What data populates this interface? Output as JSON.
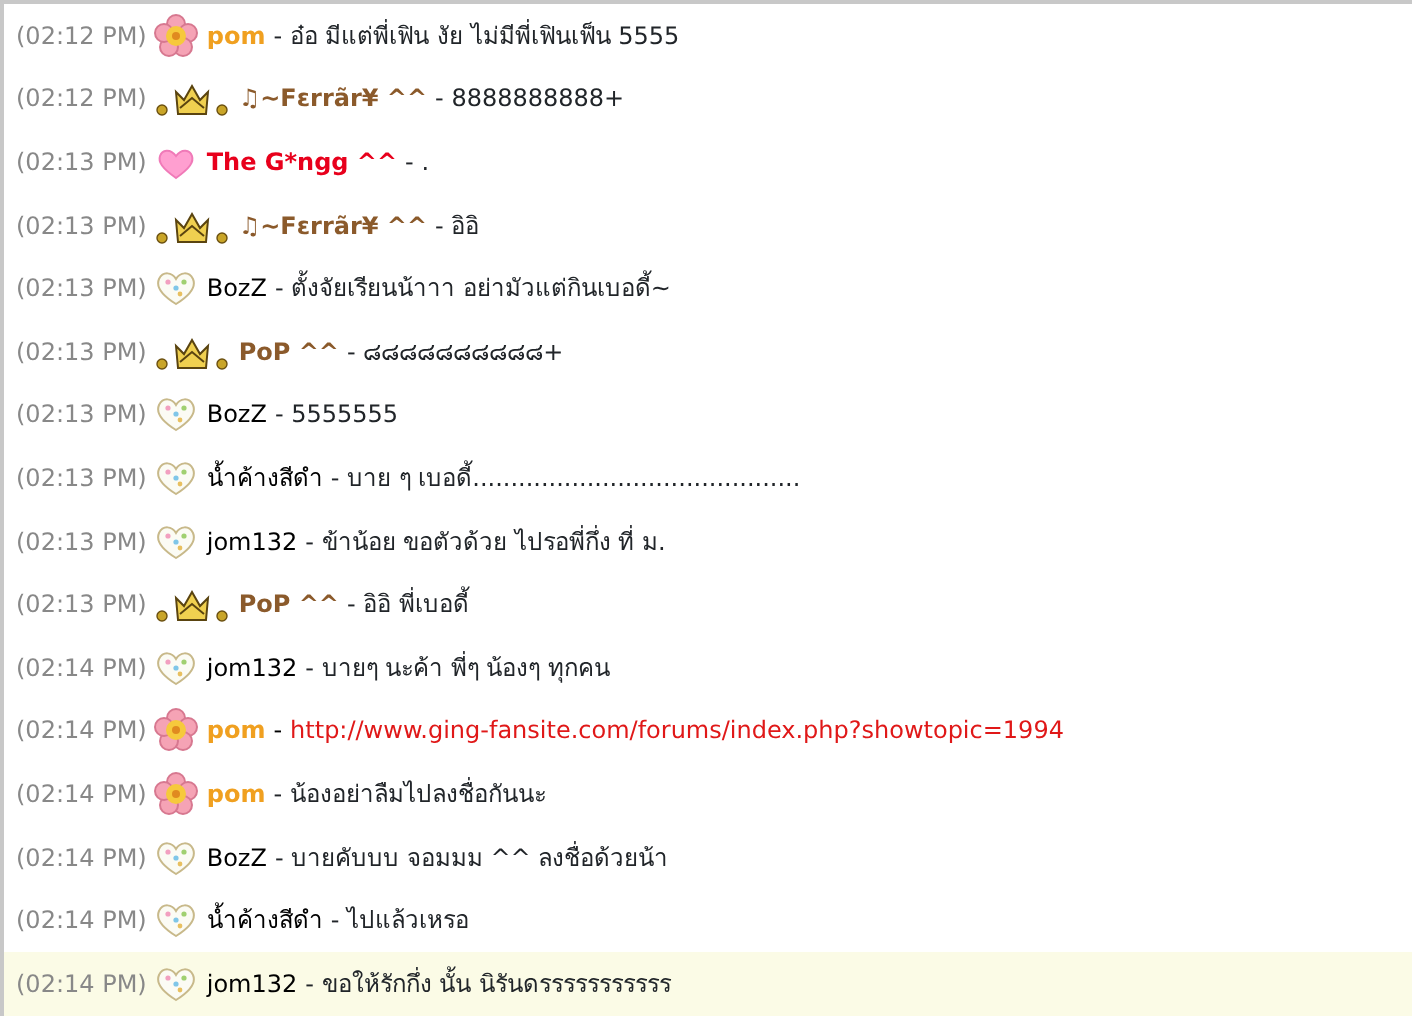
{
  "messages": [
    {
      "time": "(02:12 PM)",
      "kind": "flower",
      "name": "pom",
      "color": "#f0a020",
      "bold": true,
      "text": "- อ๋อ มีแต่พี่เฟิน งัย ไม่มีพี่เฟินเฟ็น 5555",
      "link": false,
      "selected": false
    },
    {
      "time": "(02:12 PM)",
      "kind": "crown",
      "name": "♫~Fɛrrãr¥ ^^",
      "color": "#8b5a2b",
      "bold": true,
      "text": "- 8888888888+",
      "link": false,
      "selected": false
    },
    {
      "time": "(02:13 PM)",
      "kind": "pink-heart",
      "name": "The G*ngg ^^",
      "color": "#e8001c",
      "bold": true,
      "text": "- .",
      "link": false,
      "selected": false
    },
    {
      "time": "(02:13 PM)",
      "kind": "crown",
      "name": "♫~Fɛrrãr¥ ^^",
      "color": "#8b5a2b",
      "bold": true,
      "text": "- อิอิ",
      "link": false,
      "selected": false
    },
    {
      "time": "(02:13 PM)",
      "kind": "heart",
      "name": "BozZ",
      "color": "#000000",
      "bold": false,
      "text": "- ตั้งจัยเรียนน้าาา อย่ามัวแต่กินเบอดี้~",
      "link": false,
      "selected": false
    },
    {
      "time": "(02:13 PM)",
      "kind": "crown",
      "name": "PoP ^^",
      "color": "#8b5a2b",
      "bold": true,
      "text": "- ๘๘๘๘๘๘๘๘๘๘+",
      "link": false,
      "selected": false
    },
    {
      "time": "(02:13 PM)",
      "kind": "heart",
      "name": "BozZ",
      "color": "#000000",
      "bold": false,
      "text": "- 5555555",
      "link": false,
      "selected": false
    },
    {
      "time": "(02:13 PM)",
      "kind": "heart",
      "name": "น้ำค้างสีดำ",
      "color": "#000000",
      "bold": false,
      "text": "- บาย ๆ เบอดี้...........................................",
      "link": false,
      "selected": false
    },
    {
      "time": "(02:13 PM)",
      "kind": "heart",
      "name": "jom132",
      "color": "#000000",
      "bold": false,
      "text": "- ข้าน้อย ขอตัวด้วย ไปรอพี่กึ่ง ที่ ม.",
      "link": false,
      "selected": false
    },
    {
      "time": "(02:13 PM)",
      "kind": "crown",
      "name": "PoP ^^",
      "color": "#8b5a2b",
      "bold": true,
      "text": "- อิอิ พี่เบอดี้",
      "link": false,
      "selected": false
    },
    {
      "time": "(02:14 PM)",
      "kind": "heart",
      "name": "jom132",
      "color": "#000000",
      "bold": false,
      "text": "- บายๆ นะค้า พี่ๆ น้องๆ ทุกคน",
      "link": false,
      "selected": false
    },
    {
      "time": "(02:14 PM)",
      "kind": "flower",
      "name": "pom",
      "color": "#f0a020",
      "bold": true,
      "prefix": "-",
      "text": "http://www.ging-fansite.com/forums/index.php?showtopic=1994",
      "link": true,
      "selected": false
    },
    {
      "time": "(02:14 PM)",
      "kind": "flower",
      "name": "pom",
      "color": "#f0a020",
      "bold": true,
      "text": "- น้องอย่าลืมไปลงชื่อกันนะ",
      "link": false,
      "selected": false
    },
    {
      "time": "(02:14 PM)",
      "kind": "heart",
      "name": "BozZ",
      "color": "#000000",
      "bold": false,
      "text": "- บายคับบบ จอมมม ^^ ลงชื่อด้วยน้า",
      "link": false,
      "selected": false
    },
    {
      "time": "(02:14 PM)",
      "kind": "heart",
      "name": "น้ำค้างสีดำ",
      "color": "#000000",
      "bold": false,
      "text": "- ไปแล้วเหรอ",
      "link": false,
      "selected": false
    },
    {
      "time": "(02:14 PM)",
      "kind": "heart",
      "name": "jom132",
      "color": "#000000",
      "bold": false,
      "text": "- ขอให้รักกึ่ง นั้น นิรันดรรรรรรรรรรร",
      "link": false,
      "selected": true
    }
  ]
}
